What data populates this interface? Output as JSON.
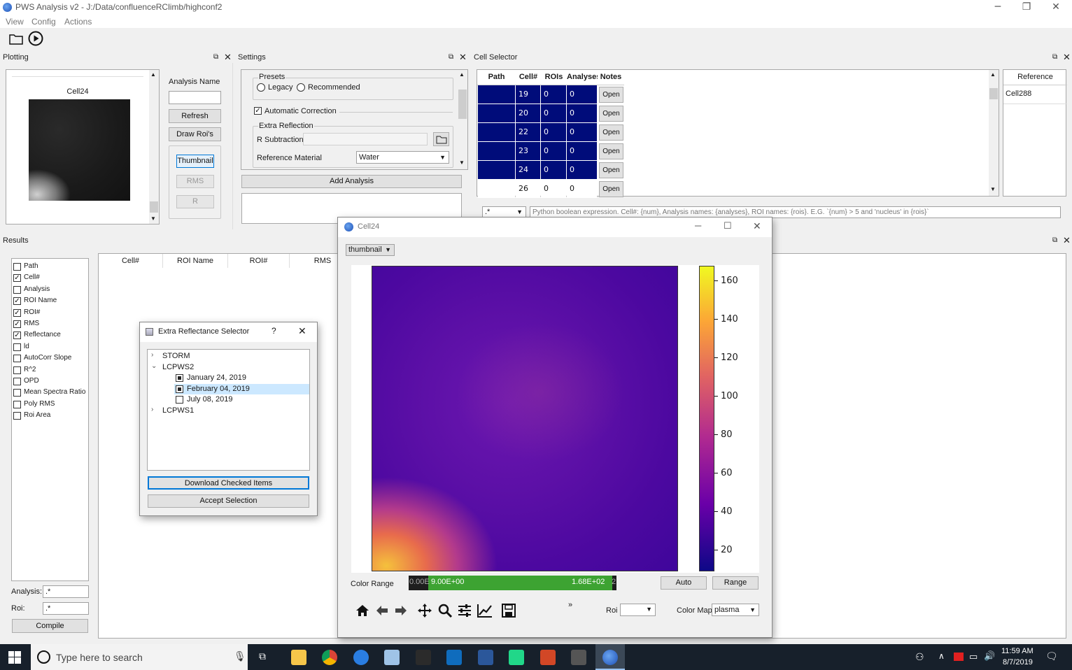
{
  "window": {
    "title": "PWS Analysis v2 - J:/Data/confluenceRClimb/highconf2",
    "min": "─",
    "restore": "❐",
    "close": "✕"
  },
  "menu": [
    "View",
    "Config",
    "Actions"
  ],
  "plotting": {
    "title": "Plotting",
    "cell_name": "Cell24",
    "analysis_name_label": "Analysis Name",
    "analysis_name_value": "",
    "refresh": "Refresh",
    "draw_rois": "Draw Roi's",
    "thumbnail": "Thumbnail",
    "rms": "RMS",
    "r": "R"
  },
  "settings": {
    "title": "Settings",
    "presets_label": "Presets",
    "legacy": "Legacy",
    "recommended": "Recommended",
    "automatic_correction": "Automatic Correction",
    "extra_reflection": "Extra Reflection",
    "r_subtraction": "R Subtraction",
    "reference_material": "Reference Material",
    "reference_material_value": "Water",
    "add_analysis": "Add Analysis"
  },
  "cell_selector": {
    "title": "Cell Selector",
    "columns": [
      "Path",
      "Cell#",
      "ROIs",
      "Analyses",
      "Notes"
    ],
    "rows": [
      {
        "cell": "19",
        "rois": "0",
        "analyses": "0",
        "notes": "Open",
        "selected": true
      },
      {
        "cell": "20",
        "rois": "0",
        "analyses": "0",
        "notes": "Open",
        "selected": true
      },
      {
        "cell": "22",
        "rois": "0",
        "analyses": "0",
        "notes": "Open",
        "selected": true
      },
      {
        "cell": "23",
        "rois": "0",
        "analyses": "0",
        "notes": "Open",
        "selected": true
      },
      {
        "cell": "24",
        "rois": "0",
        "analyses": "0",
        "notes": "Open",
        "selected": true
      },
      {
        "cell": "26",
        "rois": "0",
        "analyses": "0",
        "notes": "Open",
        "selected": false
      }
    ],
    "reference_header": "Reference",
    "reference_value": "Cell288",
    "filter_combo": ".*",
    "filter_placeholder": "Python boolean expression. Cell#: {num}, Analysis names: {analyses}, ROI names: {rois}. E.G. `{num} > 5 and 'nucleus' in {rois}`"
  },
  "results": {
    "title": "Results",
    "checkboxes": [
      {
        "label": "Path",
        "checked": false
      },
      {
        "label": "Cell#",
        "checked": true
      },
      {
        "label": "Analysis",
        "checked": false
      },
      {
        "label": "ROI Name",
        "checked": true
      },
      {
        "label": "ROI#",
        "checked": true
      },
      {
        "label": "RMS",
        "checked": true
      },
      {
        "label": "Reflectance",
        "checked": true
      },
      {
        "label": "ld",
        "checked": false
      },
      {
        "label": "AutoCorr Slope",
        "checked": false
      },
      {
        "label": "R^2",
        "checked": false
      },
      {
        "label": "OPD",
        "checked": false
      },
      {
        "label": "Mean Spectra Ratio",
        "checked": false
      },
      {
        "label": "Poly RMS",
        "checked": false
      },
      {
        "label": "Roi Area",
        "checked": false
      }
    ],
    "analysis_label": "Analysis:",
    "analysis_value": ".*",
    "roi_label": "Roi:",
    "roi_value": ".*",
    "compile": "Compile",
    "columns": [
      "Cell#",
      "ROI Name",
      "ROI#",
      "RMS"
    ]
  },
  "extra_reflectance_dialog": {
    "title": "Extra Reflectance Selector",
    "help": "?",
    "close": "✕",
    "tree": [
      {
        "label": "STORM",
        "expanded": false
      },
      {
        "label": "LCPWS2",
        "expanded": true,
        "children": [
          {
            "label": "January 24, 2019",
            "state": "partial"
          },
          {
            "label": "February 04, 2019",
            "state": "partial",
            "selected": true
          },
          {
            "label": "July 08, 2019",
            "state": "unchecked"
          }
        ]
      },
      {
        "label": "LCPWS1",
        "expanded": false
      }
    ],
    "download": "Download Checked Items",
    "accept": "Accept Selection"
  },
  "cell_window": {
    "title": "Cell24",
    "view_combo": "thumbnail",
    "colorbar_ticks": [
      "160",
      "140",
      "120",
      "100",
      "80",
      "60",
      "40",
      "20"
    ],
    "color_range_label": "Color Range",
    "range_min": "0.00E",
    "range_low": "9.00E+00",
    "range_high": "1.68E+02",
    "range_max": "2",
    "auto": "Auto",
    "range": "Range",
    "more": "»",
    "roi_label": "Roi",
    "colormap_label": "Color Map",
    "colormap_value": "plasma",
    "colors": {
      "range_green": "#3da332",
      "range_dark": "#1e1e1e"
    }
  },
  "taskbar": {
    "search_placeholder": "Type here to search",
    "time": "11:59 AM",
    "date": "8/7/2019"
  }
}
